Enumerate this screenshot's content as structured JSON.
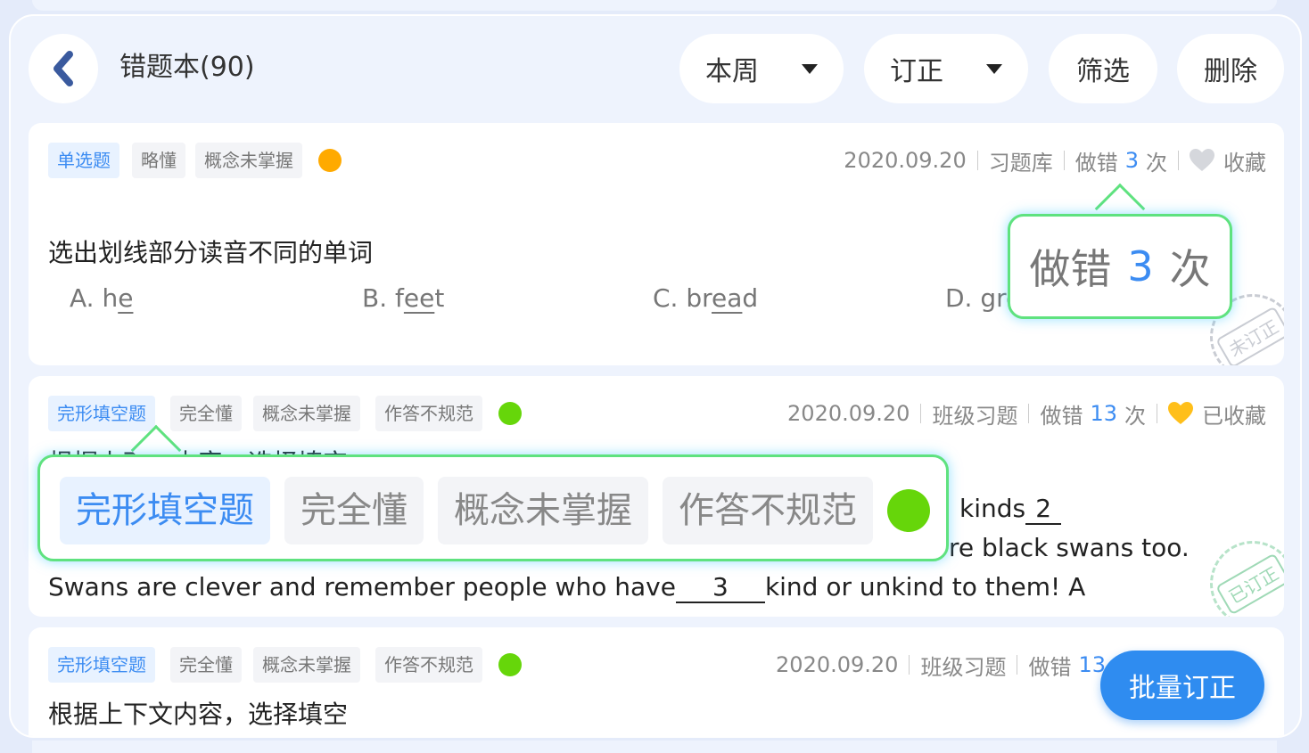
{
  "header": {
    "title": "错题本(90)",
    "back_icon": "chevron-left-icon",
    "filter_week": "本周",
    "filter_correction": "订正",
    "filter_button": "筛选",
    "delete_button": "删除"
  },
  "colors": {
    "accent": "#3c8cf2",
    "orange_dot": "#ffaa00",
    "green_dot": "#66d60a",
    "callout_border": "#5fe27f",
    "fab": "#2f8cf0"
  },
  "cards": [
    {
      "type_tag": "单选题",
      "understanding_tag": "略懂",
      "reason_tag": "概念未掌握",
      "date": "2020.09.20",
      "source": "习题库",
      "wrong_prefix": "做错",
      "wrong_count": "3",
      "wrong_suffix": "次",
      "favorite": "收藏",
      "question": "选出划线部分读音不同的单词",
      "options": [
        {
          "prefix": "A. h",
          "underlined": "e",
          "suffix": ""
        },
        {
          "prefix": "B. f",
          "underlined": "ee",
          "suffix": "t"
        },
        {
          "prefix": "C. br",
          "underlined": "ea",
          "suffix": "d"
        },
        {
          "prefix": "D. gre",
          "underlined": "",
          "suffix": ""
        }
      ],
      "stamp": "未订正"
    },
    {
      "type_tag": "完形填空题",
      "understanding_tag": "完全懂",
      "reason_tag": "概念未掌握",
      "extra_tag": "作答不规范",
      "date": "2020.09.20",
      "source": "班级习题",
      "wrong_prefix": "做错",
      "wrong_count": "13",
      "wrong_suffix": "次",
      "favorite": "已收藏",
      "question": "根据上下文内容，选择填空",
      "passage_line1_tail": "kinds",
      "passage_line1_blank": "2",
      "passage_line2_tail": "re black swans too.",
      "passage_line3_start": "Swans are clever and remember people who have",
      "passage_line3_blank": "3",
      "passage_line3_end": "kind or unkind to them! A",
      "stamp": "已订正"
    },
    {
      "type_tag": "完形填空题",
      "understanding_tag": "完全懂",
      "reason_tag": "概念未掌握",
      "extra_tag": "作答不规范",
      "date": "2020.09.20",
      "source": "班级习题",
      "wrong_prefix": "做错",
      "wrong_count": "13",
      "question": "根据上下文内容，选择填空"
    }
  ],
  "callout_wrong": {
    "prefix": "做错",
    "count": "3",
    "suffix": "次"
  },
  "callout_tags": {
    "type_tag": "完形填空题",
    "understanding_tag": "完全懂",
    "reason_tag": "概念未掌握",
    "extra_tag": "作答不规范"
  },
  "fab_label": "批量订正"
}
